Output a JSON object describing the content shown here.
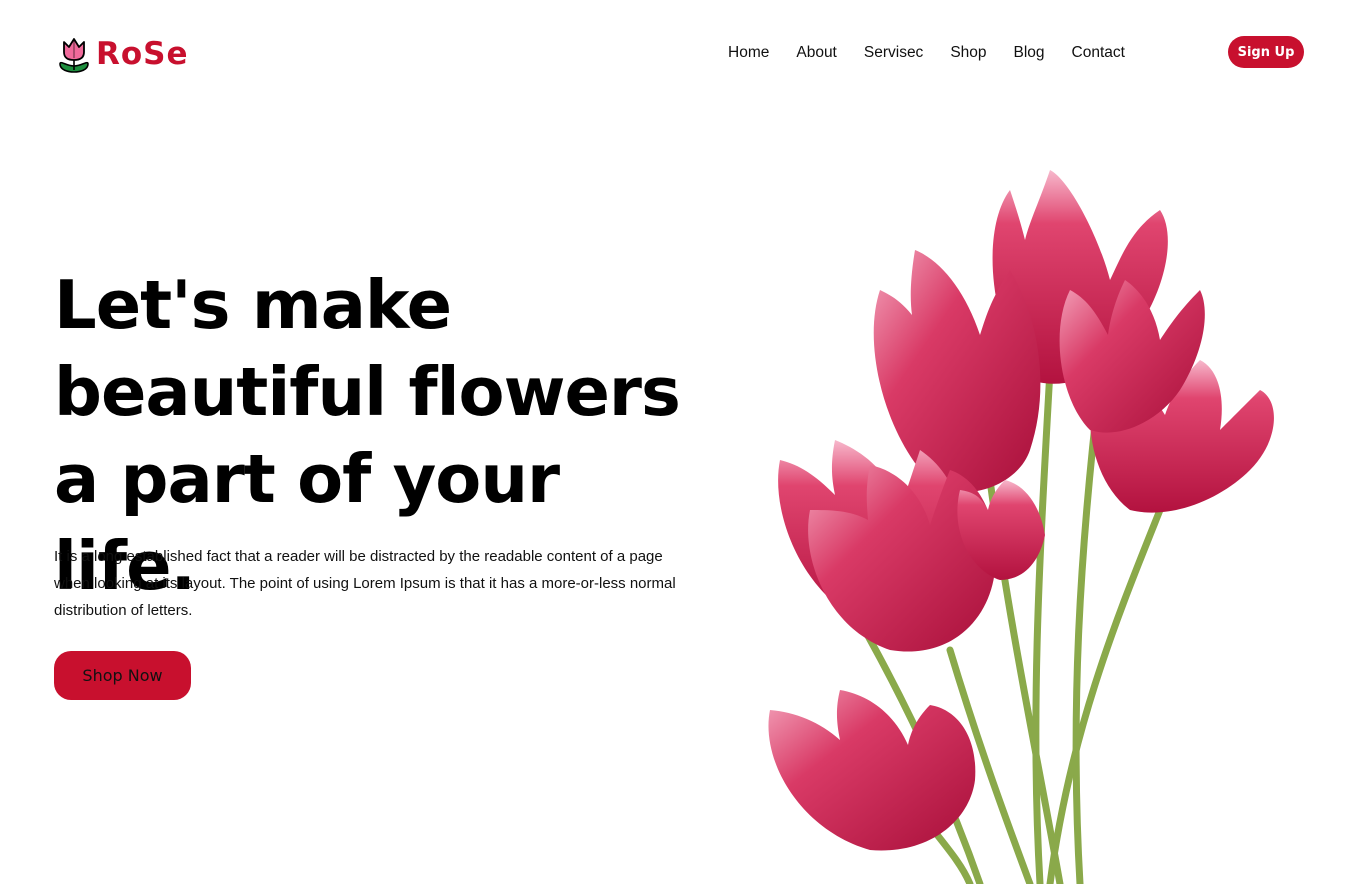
{
  "brand": {
    "name": "RoSe",
    "icon": "tulip-icon",
    "color": "#c8102e"
  },
  "nav": {
    "items": [
      {
        "label": "Home"
      },
      {
        "label": "About"
      },
      {
        "label": "Servisec"
      },
      {
        "label": "Shop"
      },
      {
        "label": "Blog"
      },
      {
        "label": "Contact"
      }
    ]
  },
  "header": {
    "signup_label": "Sign Up"
  },
  "hero": {
    "headline": "Let's make beautiful flowers a part of your life.",
    "body": "It is a long established fact that a reader will be distracted by the readable content of a page when looking at its layout. The point of using Lorem Ipsum is that it has a more-or-less normal distribution of letters.",
    "cta_label": "Shop Now",
    "image": "pink-tulips-bouquet",
    "accent": "#c8102e"
  }
}
